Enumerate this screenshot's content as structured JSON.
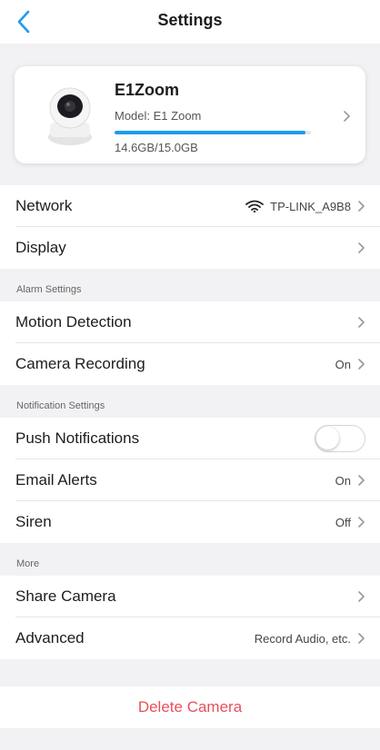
{
  "header": {
    "title": "Settings",
    "accent_color": "#1e9bf0"
  },
  "device": {
    "name": "E1Zoom",
    "model": "Model: E1 Zoom",
    "storage_text": "14.6GB/15.0GB",
    "storage_fraction": 0.973
  },
  "rows": {
    "network": {
      "label": "Network",
      "value": "TP-LINK_A9B8"
    },
    "display": {
      "label": "Display"
    },
    "motion": {
      "label": "Motion Detection"
    },
    "recording": {
      "label": "Camera Recording",
      "value": "On"
    },
    "push": {
      "label": "Push Notifications",
      "enabled": false
    },
    "email": {
      "label": "Email Alerts",
      "value": "On"
    },
    "siren": {
      "label": "Siren",
      "value": "Off"
    },
    "share": {
      "label": "Share Camera"
    },
    "advanced": {
      "label": "Advanced",
      "value": "Record Audio, etc."
    }
  },
  "sections": {
    "alarm": "Alarm Settings",
    "notification": "Notification Settings",
    "more": "More"
  },
  "delete_label": "Delete Camera",
  "colors": {
    "danger": "#e8505b",
    "background": "#f2f2f4"
  }
}
